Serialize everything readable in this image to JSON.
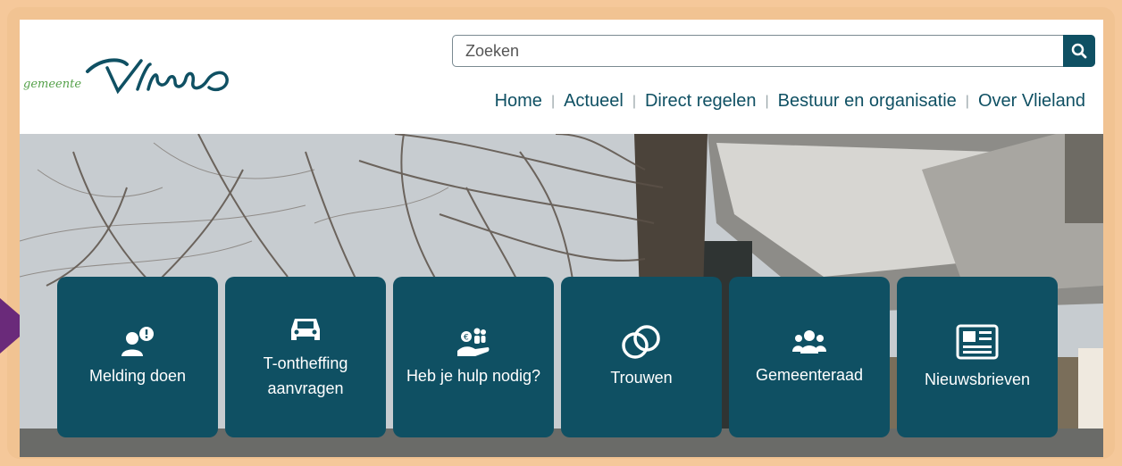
{
  "header": {
    "logo": {
      "prefix": "gemeente",
      "name": "Vlieland"
    },
    "search": {
      "placeholder": "Zoeken"
    },
    "nav": [
      "Home",
      "Actueel",
      "Direct regelen",
      "Bestuur en organisatie",
      "Over Vlieland"
    ]
  },
  "tiles": [
    {
      "label1": "Melding doen",
      "label2": "",
      "icon": "report-person-icon"
    },
    {
      "label1": "T-ontheffing",
      "label2": "aanvragen",
      "icon": "car-icon"
    },
    {
      "label1": "Heb je hulp nodig?",
      "label2": "",
      "icon": "help-hand-icon"
    },
    {
      "label1": "Trouwen",
      "label2": "",
      "icon": "rings-icon"
    },
    {
      "label1": "Gemeenteraad",
      "label2": "",
      "icon": "council-icon"
    },
    {
      "label1": "Nieuwsbrieven",
      "label2": "",
      "icon": "newspaper-icon"
    }
  ],
  "colors": {
    "accent": "#0f5063",
    "frame": "#f1c392",
    "arrow": "#6a2a7a"
  }
}
